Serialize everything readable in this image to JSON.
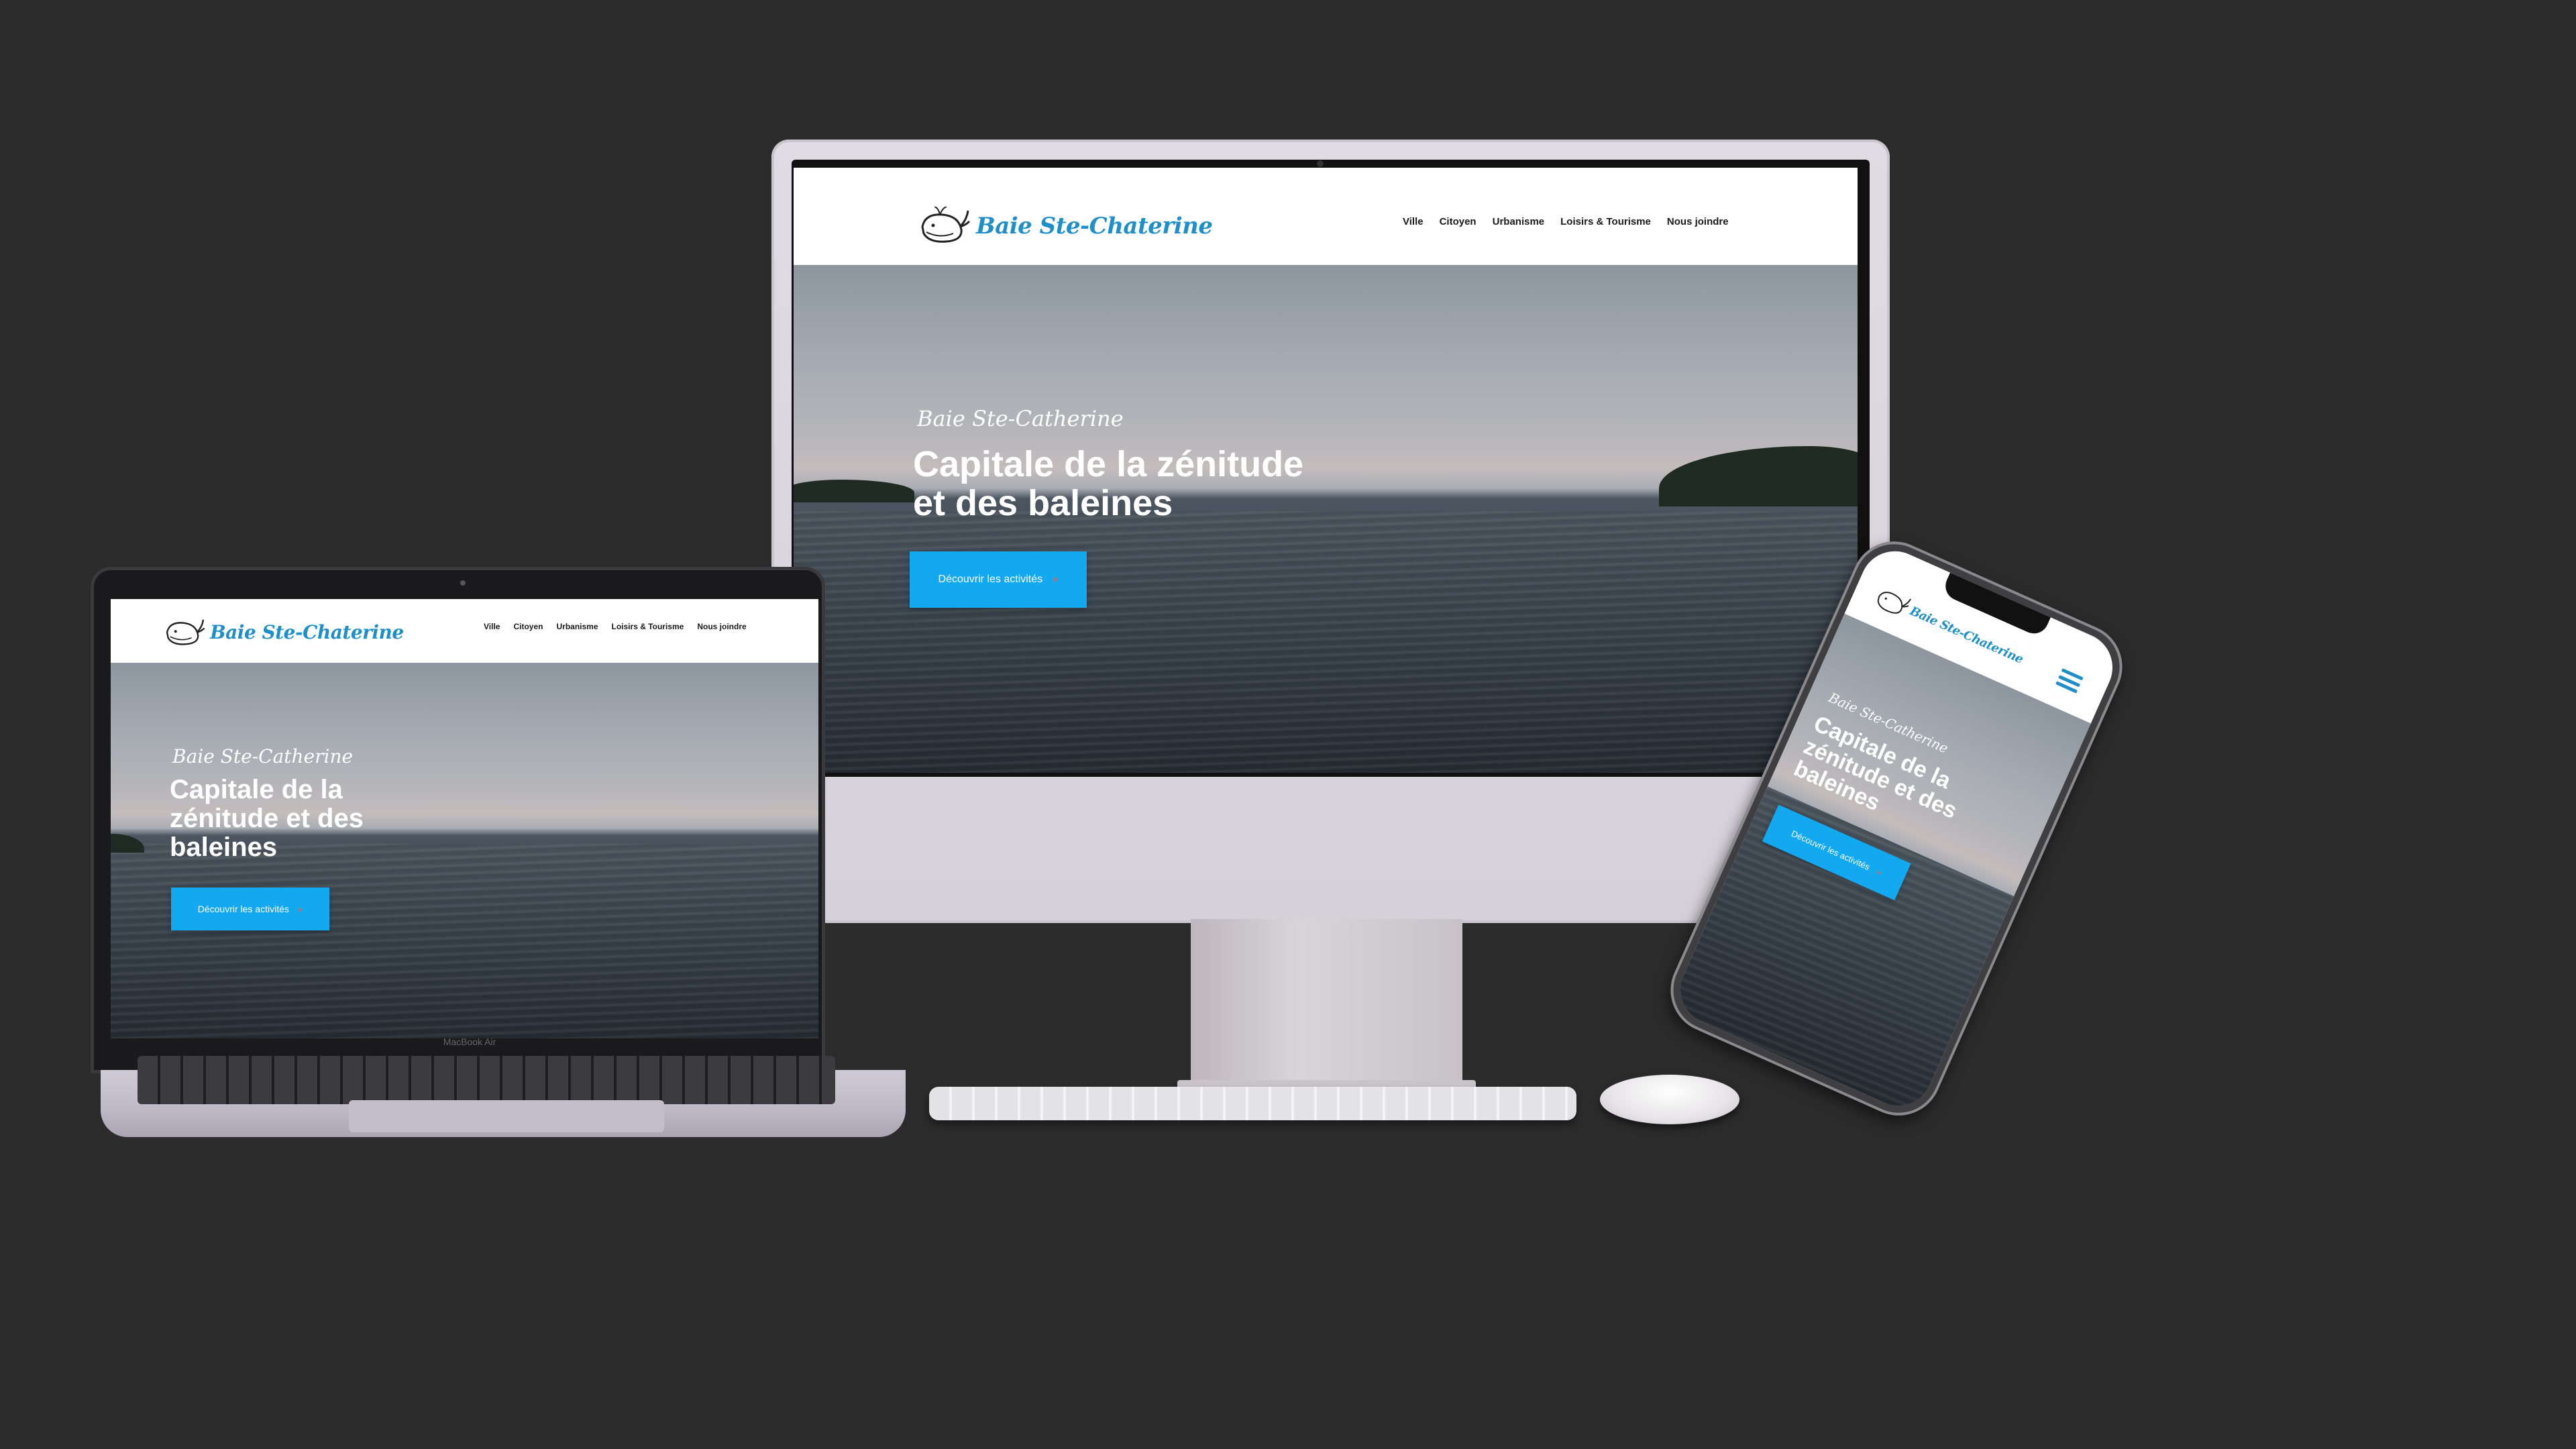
{
  "site": {
    "logo_text": "Baie Ste-Chaterine",
    "nav": [
      "Ville",
      "Citoyen",
      "Urbanisme",
      "Loisirs & Tourisme",
      "Nous joindre"
    ],
    "hero_script": "Baie Ste-Catherine",
    "hero_title": "Capitale de la zénitude et des baleines",
    "cta_label": "Découvrir les activités",
    "cta_arrow": "»"
  },
  "devices": {
    "laptop_label": "MacBook Air"
  },
  "colors": {
    "background": "#2b2b2b",
    "brand_blue": "#1e8fc9",
    "cta_blue": "#13a9f0",
    "cta_arrow": "#ff5a3c"
  },
  "icons": {
    "logo": "whale-icon",
    "menu": "hamburger-menu-icon"
  }
}
